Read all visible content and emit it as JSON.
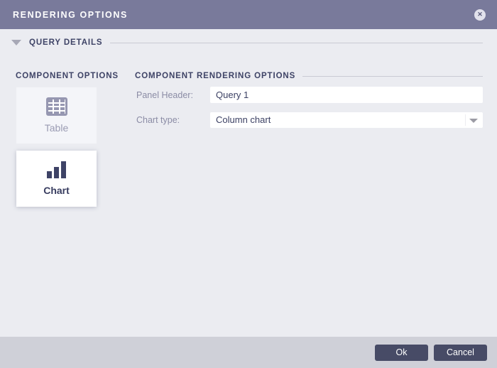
{
  "dialog": {
    "title": "RENDERING OPTIONS",
    "close_icon": "✕"
  },
  "sections": {
    "query_details": "QUERY DETAILS",
    "component_options": "COMPONENT OPTIONS",
    "component_rendering_options": "COMPONENT RENDERING OPTIONS"
  },
  "component_options": {
    "items": [
      {
        "label": "Table",
        "icon": "table-icon",
        "selected": false
      },
      {
        "label": "Chart",
        "icon": "bar-chart-icon",
        "selected": true
      }
    ]
  },
  "form": {
    "panel_header": {
      "label": "Panel Header:",
      "value": "Query 1"
    },
    "chart_type": {
      "label": "Chart type:",
      "value": "Column chart"
    }
  },
  "footer": {
    "ok_label": "Ok",
    "cancel_label": "Cancel"
  },
  "colors": {
    "header_bg": "#797a9b",
    "body_bg": "#ebecf1",
    "footer_bg": "#cfd0d8",
    "heading_text": "#3e4366",
    "muted_label": "#8b8ca5",
    "button_bg": "#474b66",
    "divider": "#c9cad3"
  }
}
